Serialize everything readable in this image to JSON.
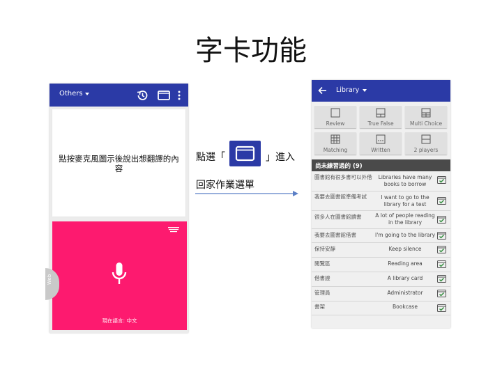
{
  "slide": {
    "title": "字卡功能"
  },
  "left_phone": {
    "appbar": {
      "title": "Others"
    },
    "prompt": "點按麥克風圖示後說出想翻譯的內容",
    "language_status": "現在語言: 中文",
    "web_tab": "Web"
  },
  "instruction": {
    "line1_before": "點選「",
    "line1_after": "」進入",
    "line2": "回家作業選單"
  },
  "right_phone": {
    "appbar": {
      "title": "Library"
    },
    "modes": [
      {
        "label": "Review",
        "icon": "review-icon"
      },
      {
        "label": "True False",
        "icon": "true-false-icon"
      },
      {
        "label": "Multi Choice",
        "icon": "multi-choice-icon"
      },
      {
        "label": "Matching",
        "icon": "matching-icon"
      },
      {
        "label": "Written",
        "icon": "written-icon"
      },
      {
        "label": "2 players",
        "icon": "two-players-icon"
      }
    ],
    "section_header": "尚未練習過的 (9)",
    "cards": [
      {
        "term": "圖書館有很多書可以外借",
        "definition": "Libraries have many books to borrow"
      },
      {
        "term": "我要去圖書館準備考試",
        "definition": "I want to go to the library for a test"
      },
      {
        "term": "很多人在圖書館讀書",
        "definition": "A lot of people reading in the library"
      },
      {
        "term": "我要去圖書館借書",
        "definition": "I'm going to the library"
      },
      {
        "term": "保持安靜",
        "definition": "Keep silence"
      },
      {
        "term": "閱覽區",
        "definition": "Reading area"
      },
      {
        "term": "借書證",
        "definition": "A library card"
      },
      {
        "term": "管理員",
        "definition": "Administrator"
      },
      {
        "term": "書架",
        "definition": "Bookcase"
      }
    ]
  },
  "colors": {
    "appbar": "#2b3aa6",
    "mic_panel": "#fd1a6f",
    "section_header": "#4a4a4a",
    "check": "#2e8b3a"
  }
}
